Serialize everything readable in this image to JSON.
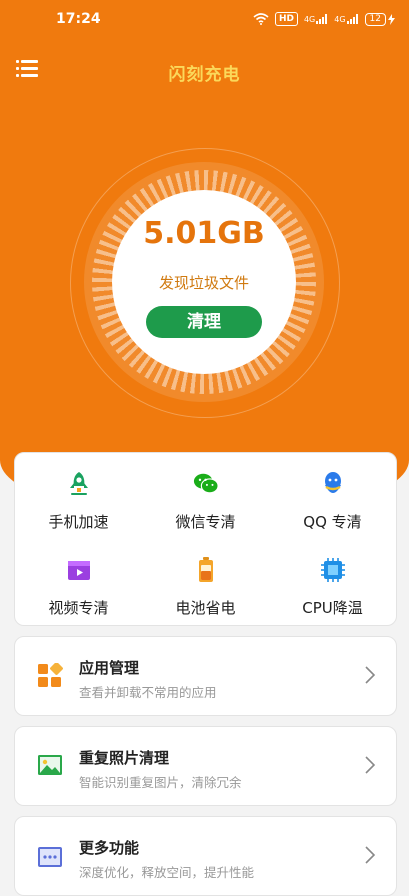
{
  "status": {
    "time": "17:24",
    "hd": "HD",
    "signal1": "4G",
    "signal2": "4G",
    "battery": "12"
  },
  "header": {
    "title": "闪刻充电"
  },
  "scan": {
    "size": "5.01GB",
    "found_label": "发现垃圾文件",
    "clean_button": "清理"
  },
  "features": [
    {
      "label": "手机加速",
      "icon": "rocket-icon"
    },
    {
      "label": "微信专清",
      "icon": "wechat-icon"
    },
    {
      "label": "QQ 专清",
      "icon": "qq-icon"
    },
    {
      "label": "视频专清",
      "icon": "video-icon"
    },
    {
      "label": "电池省电",
      "icon": "battery-icon"
    },
    {
      "label": "CPU降温",
      "icon": "cpu-icon"
    }
  ],
  "list": [
    {
      "title": "应用管理",
      "subtitle": "查看并卸载不常用的应用",
      "icon": "app-grid-icon"
    },
    {
      "title": "重复照片清理",
      "subtitle": "智能识别重复图片，清除冗余",
      "icon": "photo-icon"
    },
    {
      "title": "更多功能",
      "subtitle": "深度优化，释放空间，提升性能",
      "icon": "more-icon"
    }
  ],
  "colors": {
    "brand": "#f07a0e",
    "accent_green": "#1e9b4b",
    "title_yellow": "#fbd85a"
  }
}
